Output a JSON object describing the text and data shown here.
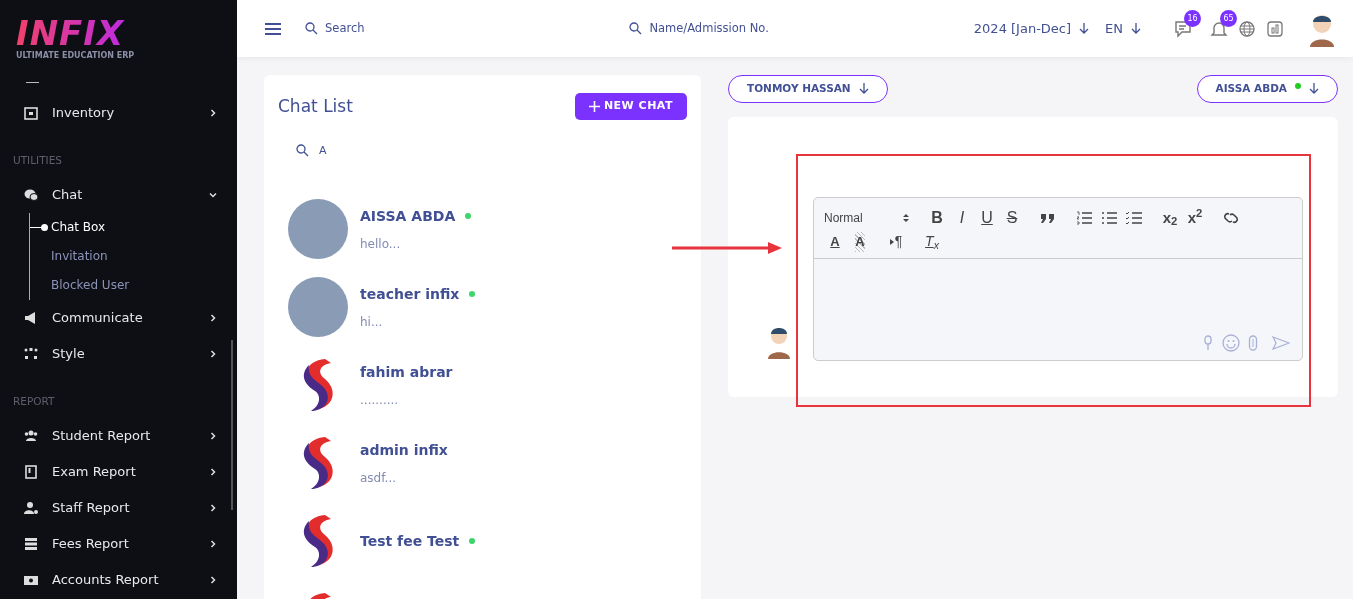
{
  "logo": {
    "text": "INFIX",
    "tagline": "ULTIMATE EDUCATION ERP"
  },
  "sidebar": {
    "items": [
      {
        "kind": "item",
        "label": "Inventory",
        "expanded": false
      },
      {
        "kind": "heading",
        "label": "UTILITIES"
      },
      {
        "kind": "item",
        "label": "Chat",
        "expanded": true,
        "children": [
          {
            "label": "Chat Box",
            "selected": true
          },
          {
            "label": "Invitation",
            "selected": false
          },
          {
            "label": "Blocked User",
            "selected": false
          }
        ]
      },
      {
        "kind": "item",
        "label": "Communicate",
        "expanded": false
      },
      {
        "kind": "item",
        "label": "Style",
        "expanded": false
      },
      {
        "kind": "heading",
        "label": "REPORT"
      },
      {
        "kind": "item",
        "label": "Student Report",
        "expanded": false
      },
      {
        "kind": "item",
        "label": "Exam Report",
        "expanded": false
      },
      {
        "kind": "item",
        "label": "Staff Report",
        "expanded": false
      },
      {
        "kind": "item",
        "label": "Fees Report",
        "expanded": false
      },
      {
        "kind": "item",
        "label": "Accounts Report",
        "expanded": false
      }
    ]
  },
  "header": {
    "search": {
      "placeholder": "Search"
    },
    "student_search": {
      "placeholder": "Name/Admission No."
    },
    "session": "2024 [Jan-Dec]",
    "language": "EN",
    "message_count": "16",
    "notification_count": "65"
  },
  "chat_list": {
    "title": "Chat List",
    "new_chat_button": "NEW CHAT",
    "search": {
      "value": "A"
    },
    "contacts": [
      {
        "kind": "photo",
        "name": "AISSA ABDA",
        "online": true,
        "preview": "hello..."
      },
      {
        "kind": "photo",
        "name": "teacher infix",
        "online": true,
        "preview": "hi..."
      },
      {
        "kind": "logo",
        "name": "fahim abrar",
        "online": false,
        "preview": ".........."
      },
      {
        "kind": "logo",
        "name": "admin infix",
        "online": false,
        "preview": "asdf..."
      },
      {
        "kind": "logo",
        "name": "Test fee Test",
        "online": true
      },
      {
        "kind": "logo"
      }
    ]
  },
  "conversation": {
    "from_button": "TONMOY HASSAN",
    "to_button": "AISSA ABDA",
    "to_online": true,
    "editor": {
      "format": "Normal",
      "toolbar": [
        {
          "kind": "bold",
          "label": "B"
        },
        {
          "kind": "italic",
          "label": "I"
        },
        {
          "kind": "underline",
          "label": "U"
        },
        {
          "kind": "strike",
          "label": "S"
        },
        {
          "kind": "quote"
        },
        {
          "kind": "ordered-list"
        },
        {
          "kind": "bullet-list"
        },
        {
          "kind": "check-list"
        },
        {
          "kind": "script",
          "label": "x$_{2}$"
        },
        {
          "kind": "script",
          "label": "x$^{2}$"
        },
        {
          "kind": "link"
        },
        {
          "kind": "color",
          "label": "A"
        },
        {
          "kind": "background",
          "label": "A"
        },
        {
          "kind": "direction",
          "label": "¶"
        },
        {
          "kind": "clean",
          "label": "T$_{x}$"
        }
      ]
    }
  }
}
